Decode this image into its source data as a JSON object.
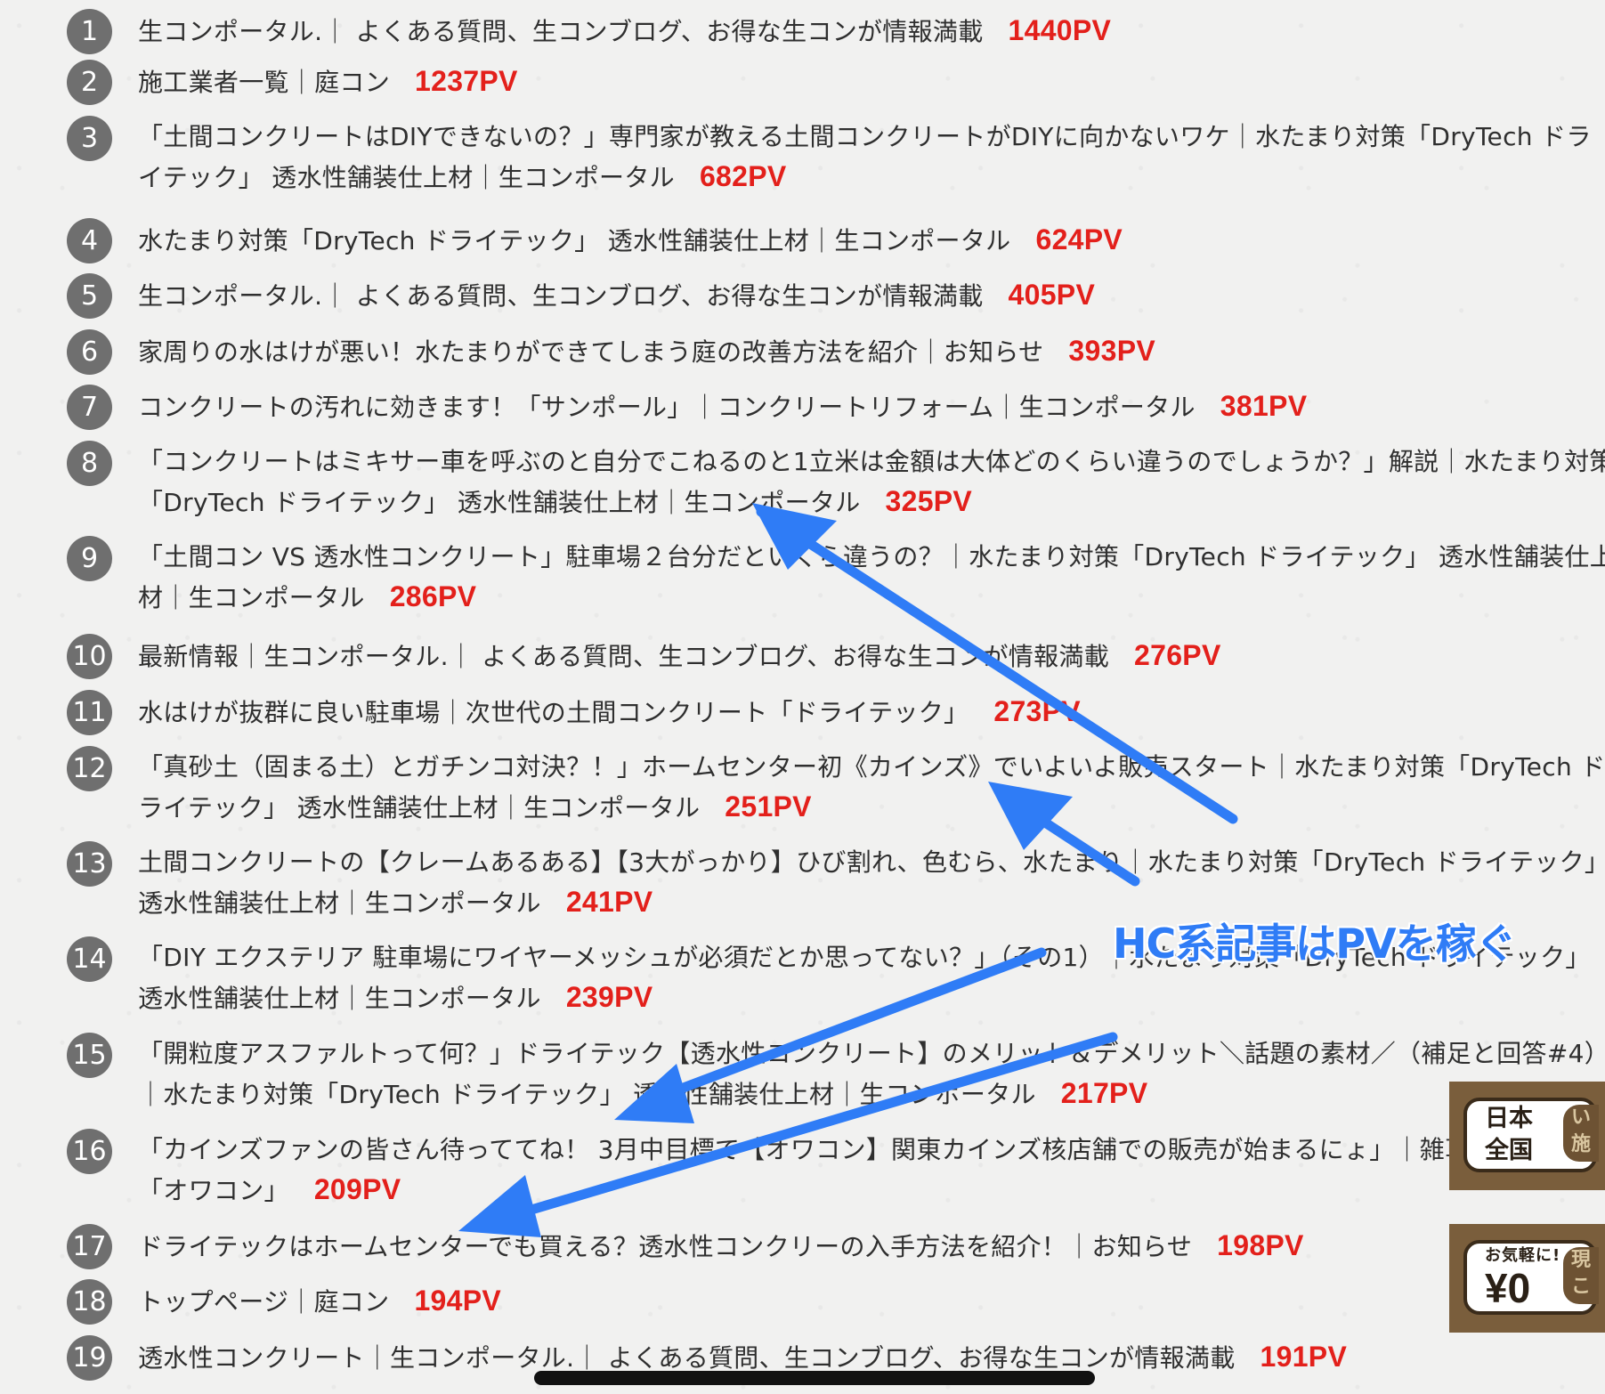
{
  "ranking": [
    {
      "rank": "1",
      "title": "生コンポータル.｜ よくある質問、生コンブログ、お得な生コンが情報満載",
      "pv": "1440PV"
    },
    {
      "rank": "2",
      "title": "施工業者一覧｜庭コン",
      "pv": "1237PV"
    },
    {
      "rank": "3",
      "title": "「土間コンクリートはDIYできないの？」専門家が教える土間コンクリートがDIYに向かないワケ｜水たまり対策「DryTech ドライテック」 透水性舗装仕上材｜生コンポータル",
      "pv": "682PV"
    },
    {
      "rank": "4",
      "title": "水たまり対策「DryTech ドライテック」 透水性舗装仕上材｜生コンポータル",
      "pv": "624PV"
    },
    {
      "rank": "5",
      "title": "生コンポータル.｜ よくある質問、生コンブログ、お得な生コンが情報満載",
      "pv": "405PV"
    },
    {
      "rank": "6",
      "title": "家周りの水はけが悪い！水たまりができてしまう庭の改善方法を紹介｜お知らせ",
      "pv": "393PV"
    },
    {
      "rank": "7",
      "title": "コンクリートの汚れに効きます！「サンポール」｜コンクリートリフォーム｜生コンポータル",
      "pv": "381PV"
    },
    {
      "rank": "8",
      "title": "「コンクリートはミキサー車を呼ぶのと自分でこねるのと1立米は金額は大体どのくらい違うのでしょうか？」解説｜水たまり対策「DryTech ドライテック」 透水性舗装仕上材｜生コンポータル",
      "pv": "325PV"
    },
    {
      "rank": "9",
      "title": "「土間コン VS 透水性コンクリート」駐車場２台分だといくら違うの？｜水たまり対策「DryTech ドライテック」 透水性舗装仕上材｜生コンポータル",
      "pv": "286PV"
    },
    {
      "rank": "10",
      "title": "最新情報｜生コンポータル.｜ よくある質問、生コンブログ、お得な生コンが情報満載",
      "pv": "276PV"
    },
    {
      "rank": "11",
      "title": "水はけが抜群に良い駐車場｜次世代の土間コンクリート「ドライテック」",
      "pv": "273PV"
    },
    {
      "rank": "12",
      "title": "「真砂土（固まる土）とガチンコ対決？！」ホームセンター初《カインズ》でいよいよ販売スタート｜水たまり対策「DryTech ドライテック」 透水性舗装仕上材｜生コンポータル",
      "pv": "251PV"
    },
    {
      "rank": "13",
      "title": "土間コンクリートの【クレームあるある】【3大がっかり】ひび割れ、色むら、水たまり｜水たまり対策「DryTech ドライテック」 透水性舗装仕上材｜生コンポータル",
      "pv": "241PV"
    },
    {
      "rank": "14",
      "title": "「DIY エクステリア 駐車場にワイヤーメッシュが必須だとか思ってない？」（その1）｜水たまり対策「DryTech ドライテック」 透水性舗装仕上材｜生コンポータル",
      "pv": "239PV"
    },
    {
      "rank": "15",
      "title": "「開粒度アスファルトって何？」ドライテック【透水性コンクリート】のメリット＆デメリット＼話題の素材／（補足と回答#4）｜水たまり対策「DryTech ドライテック」 透水性舗装仕上材｜生コンポータル",
      "pv": "217PV"
    },
    {
      "rank": "16",
      "title": "「カインズファンの皆さん待っててね！ 3月中目標で【オワコン】関東カインズ核店舗での販売が始まるにょ」｜雑草るみ対策「オワコン」",
      "pv": "209PV"
    },
    {
      "rank": "17",
      "title": "ドライテックはホームセンターでも買える？透水性コンクリーの入手方法を紹介！｜お知らせ",
      "pv": "198PV"
    },
    {
      "rank": "18",
      "title": "トップページ｜庭コン",
      "pv": "194PV"
    },
    {
      "rank": "19",
      "title": "透水性コンクリート｜生コンポータル.｜ よくある質問、生コンブログ、お得な生コンが情報満載",
      "pv": "191PV"
    }
  ],
  "annotation": "HC系記事はPVを稼ぐ",
  "badge1": {
    "line1": "日本",
    "line2": "全国",
    "side1": "い",
    "side2": "施"
  },
  "badge2": {
    "small": "お気軽に!",
    "big": "¥0",
    "side1": "現",
    "side2": "こ"
  },
  "colors": {
    "pv": "#e3201b",
    "annotation": "#2f7cf6",
    "rank_circle": "#6f6f6f"
  }
}
